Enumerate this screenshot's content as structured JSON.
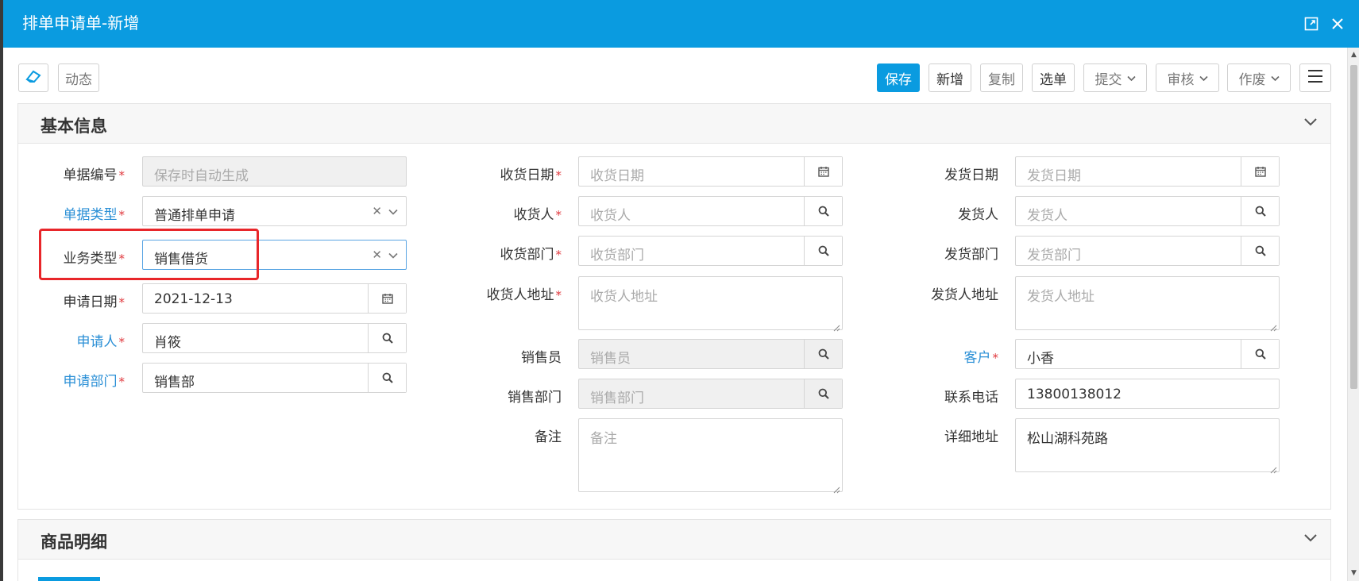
{
  "window": {
    "title": "排单申请单-新增"
  },
  "toolbar": {
    "dynamic_label": "动态",
    "save_label": "保存",
    "add_label": "新增",
    "copy_label": "复制",
    "select_label": "选单",
    "submit_label": "提交",
    "audit_label": "审核",
    "void_label": "作废"
  },
  "sections": {
    "basic_info": "基本信息",
    "product_details": "商品明细"
  },
  "form": {
    "doc_no": {
      "label": "单据编号",
      "placeholder": "保存时自动生成"
    },
    "doc_type": {
      "label": "单据类型",
      "value": "普通排单申请"
    },
    "biz_type": {
      "label": "业务类型",
      "value": "销售借货"
    },
    "apply_date": {
      "label": "申请日期",
      "value": "2021-12-13"
    },
    "applicant": {
      "label": "申请人",
      "value": "肖筱"
    },
    "apply_dept": {
      "label": "申请部门",
      "value": "销售部"
    },
    "receive_date": {
      "label": "收货日期",
      "placeholder": "收货日期"
    },
    "receiver": {
      "label": "收货人",
      "placeholder": "收货人"
    },
    "receive_dept": {
      "label": "收货部门",
      "placeholder": "收货部门"
    },
    "receiver_addr": {
      "label": "收货人地址",
      "placeholder": "收货人地址"
    },
    "salesman": {
      "label": "销售员",
      "placeholder": "销售员"
    },
    "sales_dept": {
      "label": "销售部门",
      "placeholder": "销售部门"
    },
    "remark": {
      "label": "备注",
      "placeholder": "备注"
    },
    "ship_date": {
      "label": "发货日期",
      "placeholder": "发货日期"
    },
    "shipper": {
      "label": "发货人",
      "placeholder": "发货人"
    },
    "ship_dept": {
      "label": "发货部门",
      "placeholder": "发货部门"
    },
    "shipper_addr": {
      "label": "发货人地址",
      "placeholder": "发货人地址"
    },
    "customer": {
      "label": "客户",
      "value": "小香"
    },
    "phone": {
      "label": "联系电话",
      "value": "13800138012"
    },
    "detail_addr": {
      "label": "详细地址",
      "value": "松山湖科苑路"
    }
  },
  "required_mark": "*",
  "colors": {
    "accent": "#0a9be0",
    "link": "#2a8fd6",
    "required": "#e0393e",
    "highlight": "#e8262a"
  }
}
